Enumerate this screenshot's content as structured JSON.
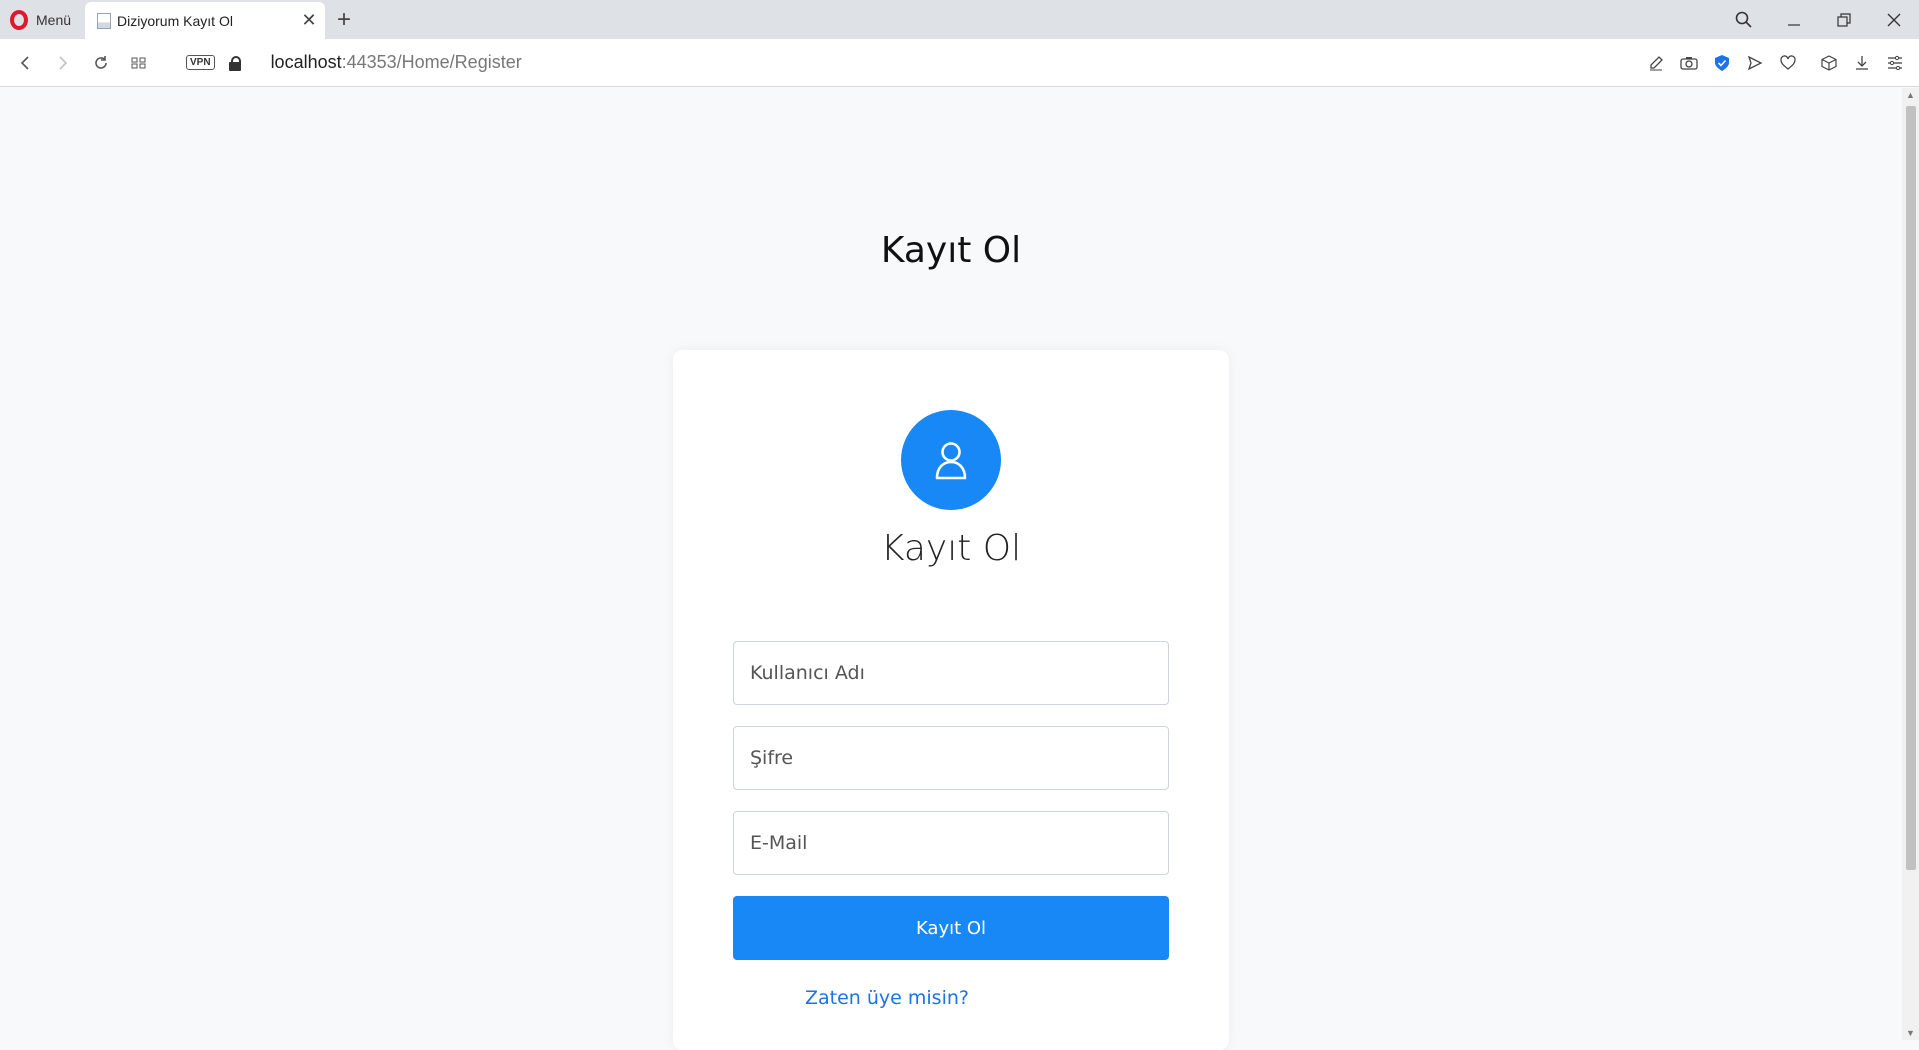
{
  "browser": {
    "menu_label": "Menü",
    "tab_title": "Diziyorum Kayıt Ol",
    "url_host": "localhost",
    "url_rest": ":44353/Home/Register",
    "vpn_label": "VPN"
  },
  "page": {
    "heading": "Kayıt Ol",
    "card_title": "Kayıt Ol",
    "fields": {
      "username_placeholder": "Kullanıcı Adı",
      "password_placeholder": "Şifre",
      "email_placeholder": "E-Mail"
    },
    "submit_label": "Kayıt Ol",
    "login_link": "Zaten üye misin?"
  },
  "colors": {
    "accent": "#1788f5",
    "link": "#1a73e8",
    "page_bg": "#f8f9fb"
  }
}
